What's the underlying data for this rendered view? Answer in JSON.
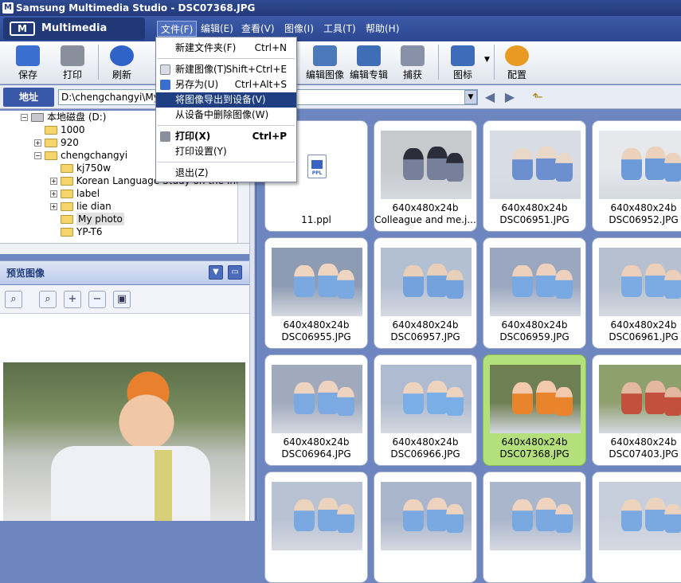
{
  "window": {
    "title": "Samsung Multimedia Studio - DSC07368.JPG",
    "app_icon_label": "M"
  },
  "logo": {
    "text": "Multimedia Studio",
    "mark": "M"
  },
  "menubar": [
    {
      "label": "文件(F)"
    },
    {
      "label": "编辑(E)"
    },
    {
      "label": "查看(V)"
    },
    {
      "label": "图像(I)"
    },
    {
      "label": "工具(T)"
    },
    {
      "label": "帮助(H)"
    }
  ],
  "toolbar": [
    {
      "label": "保存",
      "icon": "save-icon",
      "color": "#3a6fd0"
    },
    {
      "label": "打印",
      "icon": "printer-icon",
      "color": "#8a8f9e"
    },
    {
      "label": "刷新",
      "icon": "refresh-icon",
      "color": "#2f63c8"
    },
    {
      "label": "编辑图像",
      "icon": "edit-image-icon",
      "color": "#4a78b8"
    },
    {
      "label": "编辑专辑",
      "icon": "edit-album-icon",
      "color": "#3e6fb6"
    },
    {
      "label": "捕获",
      "icon": "capture-icon",
      "color": "#8792a8"
    },
    {
      "label": "图标",
      "icon": "icon-view-icon",
      "color": "#3f6cb8"
    },
    {
      "label": "配置",
      "icon": "config-icon",
      "color": "#e79b22"
    }
  ],
  "address": {
    "label": "地址",
    "value": "D:\\chengchangyi\\My p"
  },
  "tree": [
    {
      "label": "本地磁盘 (D:)",
      "level": 0,
      "expander": "−",
      "kind": "drive"
    },
    {
      "label": "1000",
      "level": 1,
      "expander": "",
      "kind": "folder"
    },
    {
      "label": "920",
      "level": 1,
      "expander": "+",
      "kind": "folder"
    },
    {
      "label": "chengchangyi",
      "level": 1,
      "expander": "−",
      "kind": "folder"
    },
    {
      "label": "kj750w",
      "level": 2,
      "expander": "",
      "kind": "folder"
    },
    {
      "label": "Korean Language Study on the Inter",
      "level": 2,
      "expander": "+",
      "kind": "folder"
    },
    {
      "label": "label",
      "level": 2,
      "expander": "+",
      "kind": "folder"
    },
    {
      "label": "lie dian",
      "level": 2,
      "expander": "+",
      "kind": "folder"
    },
    {
      "label": "My photo",
      "level": 2,
      "expander": "",
      "kind": "folder",
      "selected": true
    },
    {
      "label": "YP-T6",
      "level": 2,
      "expander": "",
      "kind": "folder"
    }
  ],
  "preview": {
    "title": "预览图像"
  },
  "file_menu": [
    {
      "label": "新建文件夹(F)",
      "shortcut": "Ctrl+N"
    },
    {
      "label": "新建图像(T)",
      "shortcut": "Shift+Ctrl+E"
    },
    {
      "label": "另存为(U)",
      "shortcut": "Ctrl+Alt+S"
    },
    {
      "label": "将图像导出到设备(V)",
      "shortcut": "",
      "highlighted": true
    },
    {
      "label": "从设备中删除图像(W)",
      "shortcut": ""
    },
    {
      "label": "打印(X)",
      "shortcut": "Ctrl+P",
      "bold": true
    },
    {
      "label": "打印设置(Y)",
      "shortcut": ""
    },
    {
      "label": "退出(Z)",
      "shortcut": ""
    }
  ],
  "ppl_icon_text": "PPL",
  "thumbnails": [
    {
      "line1": "",
      "line2": "11.ppl",
      "kind": "ppl"
    },
    {
      "line1": "640x480x24b",
      "line2": "Colleague and me.j..."
    },
    {
      "line1": "640x480x24b",
      "line2": "DSC06951.JPG"
    },
    {
      "line1": "640x480x24b",
      "line2": "DSC06952.JPG"
    },
    {
      "line1": "640x480x24b",
      "line2": "DSC06955.JPG"
    },
    {
      "line1": "640x480x24b",
      "line2": "DSC06957.JPG"
    },
    {
      "line1": "640x480x24b",
      "line2": "DSC06959.JPG"
    },
    {
      "line1": "640x480x24b",
      "line2": "DSC06961.JPG"
    },
    {
      "line1": "640x480x24b",
      "line2": "DSC06964.JPG"
    },
    {
      "line1": "640x480x24b",
      "line2": "DSC06966.JPG"
    },
    {
      "line1": "640x480x24b",
      "line2": "DSC07368.JPG",
      "selected": true
    },
    {
      "line1": "640x480x24b",
      "line2": "DSC07403.JPG"
    },
    {
      "line1": "",
      "line2": ""
    },
    {
      "line1": "",
      "line2": ""
    },
    {
      "line1": "",
      "line2": ""
    },
    {
      "line1": "",
      "line2": ""
    }
  ]
}
